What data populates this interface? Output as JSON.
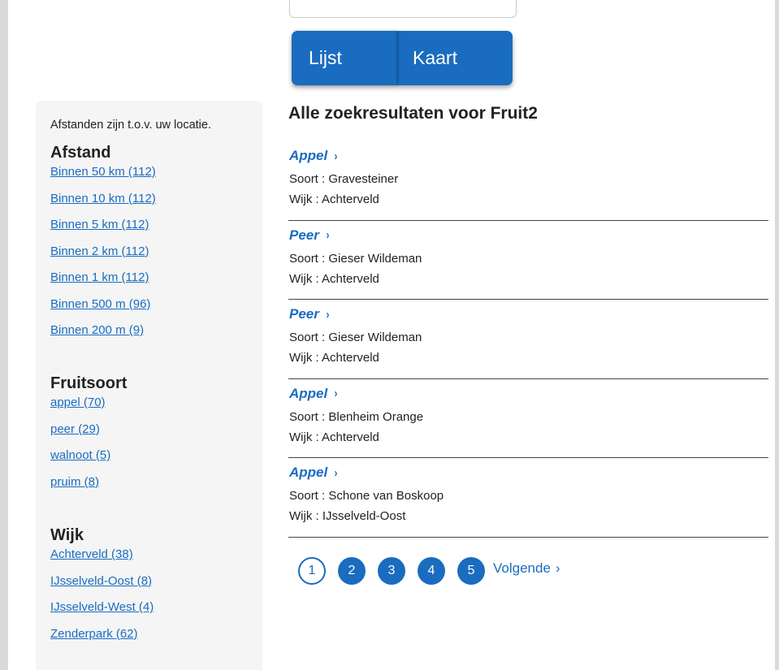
{
  "view_toggle": {
    "list_label": "Lijst",
    "map_label": "Kaart"
  },
  "sidebar": {
    "note": "Afstanden zijn t.o.v. uw locatie.",
    "distance": {
      "heading": "Afstand",
      "items": [
        "Binnen 50 km (112)",
        "Binnen 10 km (112)",
        "Binnen 5 km (112)",
        "Binnen 2 km (112)",
        "Binnen 1 km (112)",
        "Binnen 500 m (96)",
        "Binnen 200 m (9)"
      ]
    },
    "fruit": {
      "heading": "Fruitsoort",
      "items": [
        "appel (70)",
        "peer (29)",
        "walnoot (5)",
        "pruim (8)"
      ]
    },
    "district": {
      "heading": "Wijk",
      "items": [
        "Achterveld (38)",
        "IJsselveld-Oost (8)",
        "IJsselveld-West (4)",
        "Zenderpark (62)"
      ]
    }
  },
  "main": {
    "heading": "Alle zoekresultaten voor Fruit2",
    "results": [
      {
        "title": "Appel",
        "soort": "Soort : Gravesteiner",
        "wijk": "Wijk : Achterveld"
      },
      {
        "title": "Peer",
        "soort": "Soort : Gieser Wildeman",
        "wijk": "Wijk : Achterveld"
      },
      {
        "title": "Peer",
        "soort": "Soort : Gieser Wildeman",
        "wijk": "Wijk : Achterveld"
      },
      {
        "title": "Appel",
        "soort": "Soort : Blenheim Orange",
        "wijk": "Wijk : Achterveld"
      },
      {
        "title": "Appel",
        "soort": "Soort : Schone van Boskoop",
        "wijk": "Wijk : IJsselveld-Oost"
      }
    ],
    "chevron": "›"
  },
  "pager": {
    "pages": [
      "1",
      "2",
      "3",
      "4",
      "5"
    ],
    "current": "1",
    "next_label": "Volgende",
    "next_chevron": "›"
  },
  "colors": {
    "accent": "#1a6cc0",
    "sidebar_bg": "#f5f5f5"
  }
}
